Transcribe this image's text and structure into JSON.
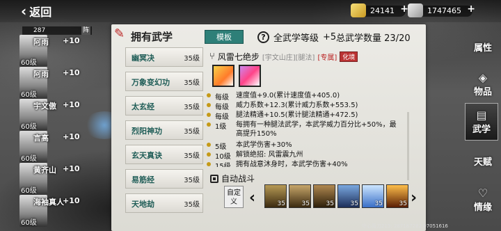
{
  "top": {
    "back_label": "返回",
    "currency": [
      {
        "icon": "gold-ingot-icon",
        "value": "24141"
      },
      {
        "icon": "silver-icon",
        "value": "1747465"
      }
    ]
  },
  "roster": {
    "header_count": "287",
    "header_tag": "阵",
    "members": [
      {
        "name": "阿雨",
        "bonus": "+10",
        "level": "60级"
      },
      {
        "name": "阿雨",
        "bonus": "+10",
        "level": "60级"
      },
      {
        "name": "宇文傲",
        "bonus": "+10",
        "level": "60级"
      },
      {
        "name": "言高",
        "bonus": "+10",
        "level": "60级"
      },
      {
        "name": "黄齐山",
        "bonus": "+10",
        "level": "60级"
      },
      {
        "name": "海袖真人",
        "bonus": "+10",
        "level": "60级"
      }
    ]
  },
  "panel": {
    "title": "拥有武学",
    "mode_button": "模板",
    "martial_level_label": "全武学等级",
    "martial_level_value": "+5",
    "total_label": "总武学数量",
    "total_value": "23/20"
  },
  "skills": [
    {
      "name": "幽冥决",
      "level": "35级"
    },
    {
      "name": "万象变幻功",
      "level": "35级"
    },
    {
      "name": "太玄经",
      "level": "35级"
    },
    {
      "name": "烈阳神功",
      "level": "35级"
    },
    {
      "name": "玄天真诀",
      "level": "35级"
    },
    {
      "name": "易筋经",
      "level": "35级"
    },
    {
      "name": "天地劫",
      "level": "35级"
    }
  ],
  "detail": {
    "name": "风雷七绝步",
    "meta": "[宇文山庄][腿法]",
    "special": "[专属]",
    "tag": "化境",
    "effects": [
      {
        "lv": "每级",
        "text": "速度值+9.0(累计速度值+405.0)"
      },
      {
        "lv": "每级",
        "text": "威力系数+12.3(累计威力系数+553.5)"
      },
      {
        "lv": "每级",
        "text": "腿法精通+10.5(累计腿法精通+472.5)"
      },
      {
        "lv": "1级",
        "text": "每拥有一种腿法武学，本武学威力百分比+50%，最高提升150%"
      },
      {
        "lv": "5级",
        "text": "本武学伤害+30%"
      },
      {
        "lv": "10级",
        "text": "解锁绝招:   风雷震九州"
      },
      {
        "lv": "15级",
        "text": "拥有战意沐身时，本武学伤害+40%"
      }
    ]
  },
  "auto_battle": {
    "label": "自动战斗",
    "custom": "自定义",
    "slot_levels": [
      "35",
      "35",
      "35",
      "35",
      "35",
      "35"
    ]
  },
  "nav": [
    {
      "label": "属性",
      "icon": "attribute-icon"
    },
    {
      "label": "物品",
      "icon": "item-icon"
    },
    {
      "label": "武学",
      "icon": "martial-icon"
    },
    {
      "label": "天赋",
      "icon": "talent-icon"
    },
    {
      "label": "情缘",
      "icon": "bond-icon"
    }
  ],
  "footer": "守心背刀215: 287187282 07051616",
  "colors": {
    "mode_button": "#2e7f78",
    "skill_name": "#1e5c56",
    "special_tag": "#b33333"
  }
}
